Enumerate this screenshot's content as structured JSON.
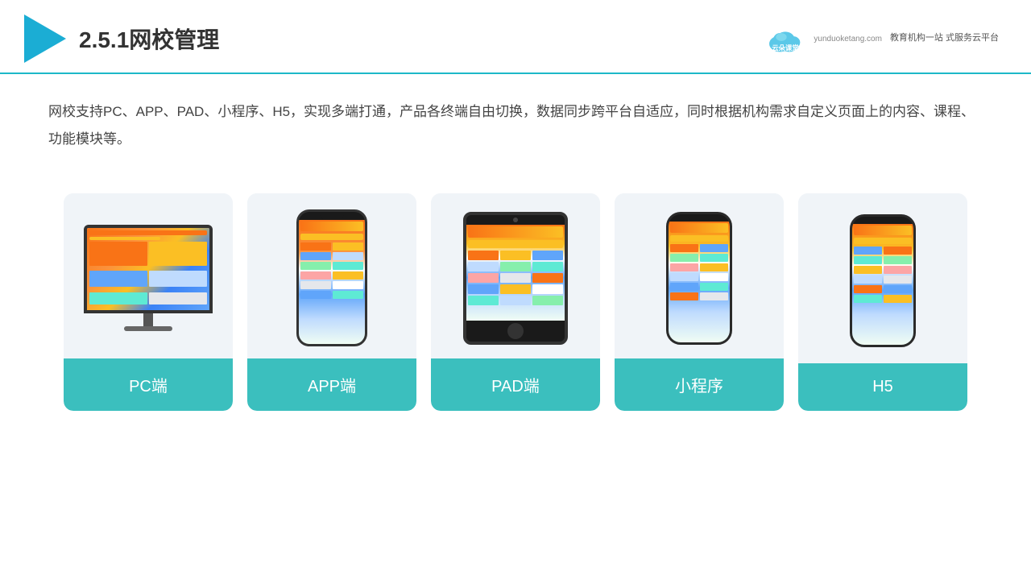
{
  "header": {
    "title": "2.5.1网校管理",
    "brand": {
      "name": "云朵课堂",
      "url": "yunduoketang.com",
      "slogan": "教育机构一站\n式服务云平台"
    }
  },
  "description": "网校支持PC、APP、PAD、小程序、H5，实现多端打通，产品各终端自由切换，数据同步跨平台自适应，同时根据机构需求自定义页面上的内容、课程、功能模块等。",
  "cards": [
    {
      "id": "pc",
      "label": "PC端"
    },
    {
      "id": "app",
      "label": "APP端"
    },
    {
      "id": "pad",
      "label": "PAD端"
    },
    {
      "id": "miniapp",
      "label": "小程序"
    },
    {
      "id": "h5",
      "label": "H5"
    }
  ]
}
